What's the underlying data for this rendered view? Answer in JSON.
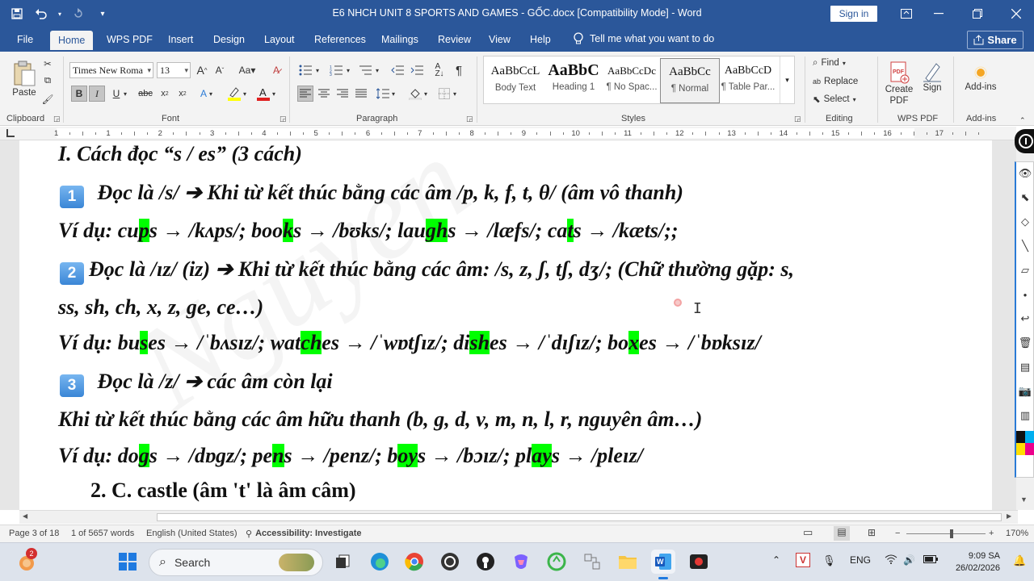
{
  "window": {
    "title": "E6 NHCH UNIT 8 SPORTS AND GAMES - GỐC.docx [Compatibility Mode]  -  Word",
    "sign_in": "Sign in"
  },
  "tabs": [
    "File",
    "Home",
    "WPS PDF",
    "Insert",
    "Design",
    "Layout",
    "References",
    "Mailings",
    "Review",
    "View",
    "Help"
  ],
  "tell_me": "Tell me what you want to do",
  "share": "Share",
  "ribbon": {
    "clipboard": {
      "paste": "Paste",
      "label": "Clipboard"
    },
    "font": {
      "name": "Times New Roma",
      "size": "13",
      "label": "Font"
    },
    "paragraph": {
      "label": "Paragraph"
    },
    "styles": {
      "label": "Styles",
      "items": [
        {
          "sample": "AaBbCcL",
          "name": "Body Text"
        },
        {
          "sample": "AaBbC",
          "name": "Heading 1"
        },
        {
          "sample": "AaBbCcDc",
          "name": "¶ No Spac..."
        },
        {
          "sample": "AaBbCc",
          "name": "¶ Normal"
        },
        {
          "sample": "AaBbCcD",
          "name": "¶ Table Par..."
        }
      ]
    },
    "editing": {
      "find": "Find",
      "replace": "Replace",
      "select": "Select",
      "label": "Editing"
    },
    "wps_pdf": {
      "create": "Create PDF",
      "sign": "Sign",
      "label": "WPS PDF"
    },
    "addins": {
      "button": "Add-ins",
      "label": "Add-ins"
    }
  },
  "ruler": {
    "numbers": [
      "1",
      "1",
      "2",
      "3",
      "4",
      "5",
      "6",
      "7",
      "8",
      "9",
      "10",
      "11",
      "12",
      "13",
      "14",
      "15",
      "16",
      "17"
    ]
  },
  "document": {
    "heading": "I. Cách đọc “s / es” (3 cách)",
    "rule1": {
      "badge": "1",
      "text": " Đọc là /s/ ➔ Khi từ kết thúc bằng các âm /p, k, f, t, θ/ (âm vô thanh)"
    },
    "ex1": {
      "prefix": "Ví dụ: ",
      "w1a": "cu",
      "w1h": "p",
      "w1b": "s → /kʌps/; ",
      "w2a": "boo",
      "w2h": "k",
      "w2b": "s → /bʊks/; ",
      "w3a": "lau",
      "w3h": "gh",
      "w3b": "s → /læfs/; ",
      "w4a": "ca",
      "w4h": "t",
      "w4b": "s → /kæts/;;"
    },
    "rule2": {
      "badge": "2",
      "text": "Đọc là /ɪz/ (iz) ➔ Khi từ kết thúc bằng các âm: /s, z, ʃ, tʃ, dʒ/; (Chữ thường gặp: s,"
    },
    "rule2b": "ss, sh, ch, x, z, ge, ce…)",
    "ex2": {
      "prefix": "Ví dụ: ",
      "w1a": "bu",
      "w1h": "s",
      "w1b": "es → /ˈbʌsɪz/; ",
      "w2a": "wat",
      "w2h": "ch",
      "w2b": "es → /ˈwɒtʃɪz/; ",
      "w3a": "di",
      "w3h": "sh",
      "w3b": "es → /ˈdɪʃɪz/; ",
      "w4a": "bo",
      "w4h": "x",
      "w4b": "es → /ˈbɒksɪz/"
    },
    "rule3": {
      "badge": "3",
      "text": " Đọc là /z/ ➔ các âm còn lại"
    },
    "rule3b": "Khi từ kết thúc bằng các âm hữu thanh (b, g, d, v, m, n, l, r, nguyên âm…)",
    "ex3": {
      "prefix": "Ví dụ: ",
      "w1a": "do",
      "w1h": "g",
      "w1b": "s → /dɒgz/; ",
      "w2a": "pe",
      "w2h": "n",
      "w2b": "s → /penz/; ",
      "w3a": "b",
      "w3h": "oy",
      "w3b": "s → /bɔɪz/; ",
      "w4a": "pl",
      "w4h": "ay",
      "w4b": "s → /pleɪz/"
    },
    "item2": "2.   C. castle (âm 't' là âm câm)"
  },
  "status": {
    "page": "Page 3 of 18",
    "words": "1 of 5657 words",
    "language": "English (United States)",
    "accessibility": "Accessibility: Investigate",
    "zoom": "170%"
  },
  "taskbar": {
    "search": "Search",
    "lang": "ENG",
    "time": "9:09 SA",
    "date": "26/02/2026",
    "notif_badge": "2"
  }
}
